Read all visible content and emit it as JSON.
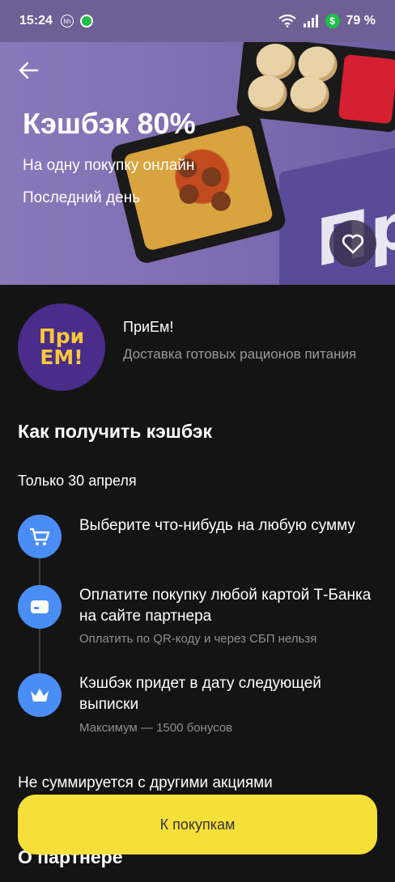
{
  "status_bar": {
    "time": "15:24",
    "hh_label": "hh",
    "battery": "79 %",
    "icons": [
      "hh-icon",
      "app-notification-icon",
      "wifi-icon",
      "signal-icon",
      "cashback-dollar-icon"
    ]
  },
  "hero": {
    "title": "Кэшбэк 80%",
    "subtitle": "На одну покупку онлайн",
    "deadline": "Последний день",
    "background_color": "#7e6cb0"
  },
  "partner": {
    "logo_line1": "При",
    "logo_line2": "ЕМ!",
    "name": "ПриЕм!",
    "description": "Доставка готовых рационов питания"
  },
  "how_to": {
    "title": "Как получить кэшбэк",
    "date_note": "Только 30 апреля",
    "steps": [
      {
        "title": "Выберите что-нибудь на любую сумму",
        "note": "",
        "icon": "cart-icon"
      },
      {
        "title": "Оплатите покупку любой картой Т-Банка на сайте партнера",
        "note": "Оплатить по QR-коду и через СБП нельзя",
        "icon": "card-icon"
      },
      {
        "title": "Кэшбэк придет в дату следующей выписки",
        "note": "Максимум — 1500 бонусов",
        "icon": "crown-icon"
      }
    ]
  },
  "no_combine": "Не суммируется с другими акциями",
  "about_partner": "О партнере",
  "cta": {
    "label": "К покупкам",
    "color": "#f7df3a"
  },
  "accent_color": "#4a8df5"
}
